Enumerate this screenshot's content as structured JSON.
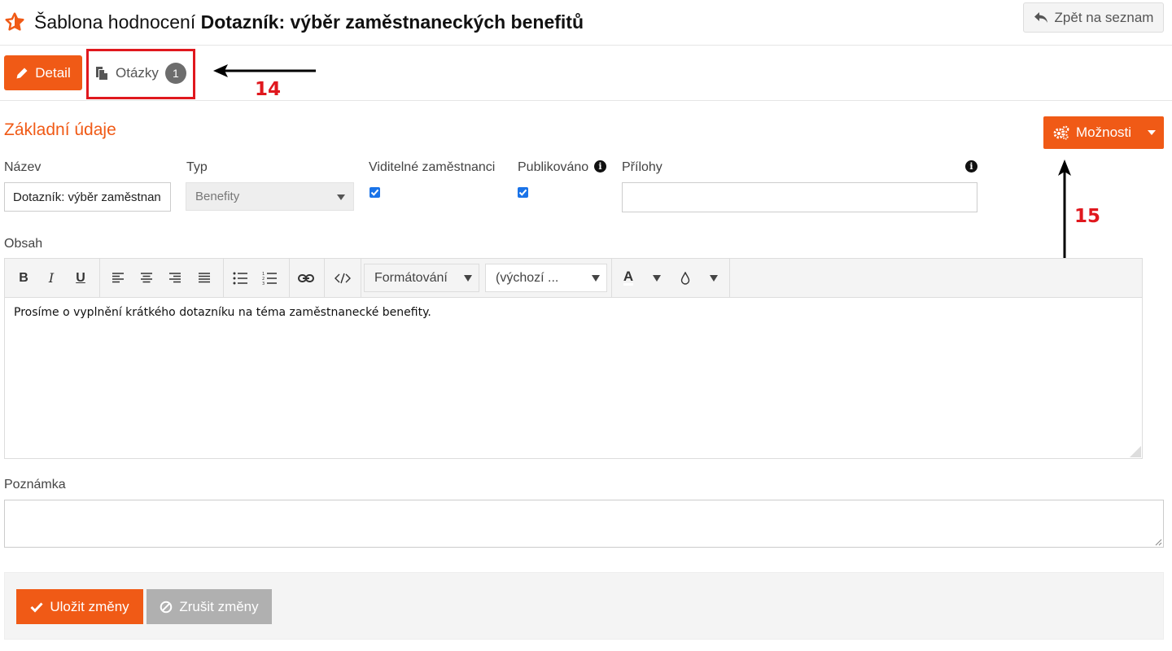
{
  "header": {
    "title_prefix": "Šablona hodnocení",
    "title_name": "Dotazník: výběr zaměstnaneckých benefitů",
    "back_label": "Zpět na seznam",
    "star_icon": "star-icon"
  },
  "tabs": {
    "detail_label": "Detail",
    "questions_label": "Otázky",
    "questions_count": "1"
  },
  "annotations": {
    "marker_14": "14",
    "marker_15": "15",
    "color": "#e0181e"
  },
  "section": {
    "title": "Základní údaje",
    "options_label": "Možnosti"
  },
  "fields": {
    "name_label": "Název",
    "name_value": "Dotazník: výběr zaměstnan",
    "type_label": "Typ",
    "type_value": "Benefity",
    "visible_label": "Viditelné zaměstnanci",
    "visible_checked": true,
    "published_label": "Publikováno",
    "published_checked": true,
    "attachments_label": "Přílohy",
    "content_label": "Obsah",
    "note_label": "Poznámka"
  },
  "editor": {
    "format_select": "Formátování",
    "font_select": "(výchozí ...",
    "content": "Prosíme o vyplnění krátkého dotazníku na téma zaměstnanecké benefity.",
    "bold": "B",
    "italic": "I",
    "underline": "U",
    "font_color": "A"
  },
  "footer": {
    "save_label": "Uložit změny",
    "cancel_label": "Zrušit změny"
  },
  "colors": {
    "accent": "#f05a16",
    "checkbox": "#1a73e8",
    "badge": "#6d6d6d"
  }
}
